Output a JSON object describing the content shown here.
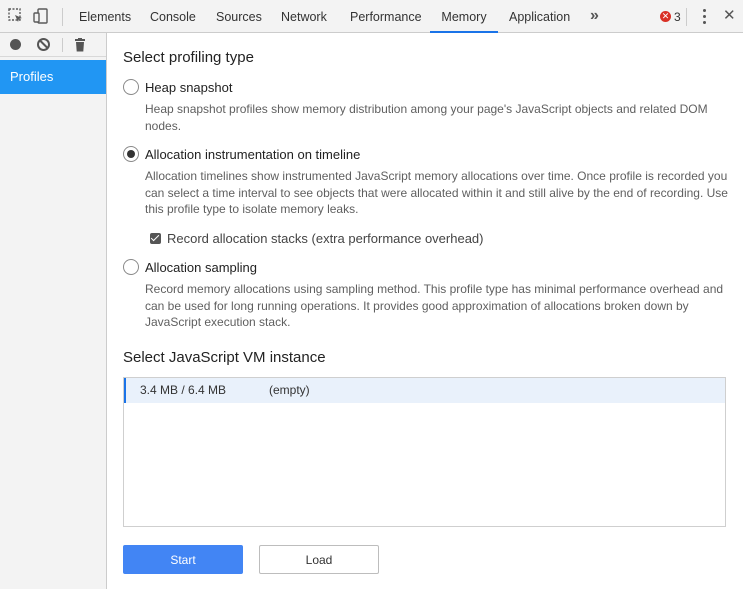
{
  "toolbar": {
    "tabs": [
      {
        "label": "Elements"
      },
      {
        "label": "Console"
      },
      {
        "label": "Sources"
      },
      {
        "label": "Network"
      },
      {
        "label": "Performance"
      },
      {
        "label": "Memory",
        "active": true
      },
      {
        "label": "Application"
      }
    ],
    "more_label": "»",
    "error_count": "3",
    "close_label": "✕",
    "accent_color": "#1a73e8",
    "error_color": "#d93025"
  },
  "sidebar": {
    "icons": [
      "record-icon",
      "clear-icon",
      "trash-icon"
    ],
    "items": [
      {
        "label": "Profiles",
        "selected": true
      }
    ],
    "selected_color": "#2196f3"
  },
  "main": {
    "profiling_title": "Select profiling type",
    "options": [
      {
        "label": "Heap snapshot",
        "checked": false,
        "desc": "Heap snapshot profiles show memory distribution among your page's JavaScript objects and related DOM nodes."
      },
      {
        "label": "Allocation instrumentation on timeline",
        "checked": true,
        "desc": "Allocation timelines show instrumented JavaScript memory allocations over time. Once profile is recorded you can select a time interval to see objects that were allocated within it and still alive by the end of recording. Use this profile type to isolate memory leaks.",
        "checkbox": {
          "label": "Record allocation stacks (extra performance overhead)",
          "checked": true
        }
      },
      {
        "label": "Allocation sampling",
        "checked": false,
        "desc": "Record memory allocations using sampling method. This profile type has minimal performance overhead and can be used for long running operations. It provides good approximation of allocations broken down by JavaScript execution stack."
      }
    ],
    "vm_title": "Select JavaScript VM instance",
    "vm_instances": [
      {
        "memory": "3.4 MB / 6.4 MB",
        "name": "(empty)",
        "selected": true
      }
    ],
    "start_label": "Start",
    "load_label": "Load",
    "start_color": "#4285f4"
  }
}
